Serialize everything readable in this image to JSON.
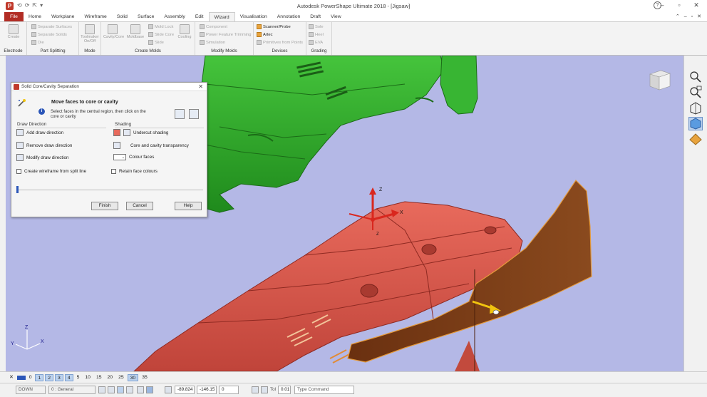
{
  "app": {
    "icon_letter": "P",
    "title": "Autodesk PowerShape Ultimate 2018 - [Jigsaw]",
    "window_controls": [
      "–",
      "▫",
      "✕"
    ],
    "help": "?",
    "quick_access": [
      "⟲",
      "⟳",
      "⇱",
      "▾"
    ]
  },
  "tabs": [
    "File",
    "Home",
    "Workplane",
    "Wireframe",
    "Solid",
    "Surface",
    "Assembly",
    "Edit",
    "Wizard",
    "Visualisation",
    "Annotation",
    "Draft",
    "View"
  ],
  "active_tab": "Wizard",
  "tabs_right": [
    "⌃",
    "–",
    "▫",
    "✕"
  ],
  "ribbon": {
    "groups": [
      {
        "label": "Electrode",
        "buttons": [
          "Create"
        ]
      },
      {
        "label": "Part Splitting",
        "buttons": [
          "Separate Surfaces",
          "Separate Solids",
          "Die"
        ]
      },
      {
        "label": "Mode",
        "buttons": [
          "Toolmaker On/Off"
        ]
      },
      {
        "label": "Create Molds",
        "buttons": [
          "Cavity/Core",
          "Moldbase",
          "Mold Lock",
          "Slide Core",
          "Slide",
          "Cooling"
        ]
      },
      {
        "label": "Modify Molds",
        "buttons": [
          "Component",
          "Power Feature Trimming",
          "Simulation"
        ]
      },
      {
        "label": "Devices",
        "buttons": [
          "Scanner/Probe",
          "Artec",
          "Primitives from Points"
        ]
      },
      {
        "label": "Grading",
        "buttons": [
          "Sole",
          "Heel",
          "EVA"
        ]
      }
    ]
  },
  "dialog": {
    "title": "Solid Core/Cavity Separation",
    "close": "✕",
    "heading": "Move faces to core or cavity",
    "info_icon": "i",
    "info": "Select faces in the central region, then click on the core or cavity",
    "draw_direction": {
      "label": "Draw Direction",
      "items": [
        "Add draw direction",
        "Remove draw direction",
        "Modify draw direction"
      ]
    },
    "shading": {
      "label": "Shading",
      "items": [
        "Undercut shading",
        "Core and cavity transparency",
        "Colour faces"
      ]
    },
    "checkboxes": {
      "wireframe": "Create wireframe from split line",
      "retain": "Retain face colours"
    },
    "slider_value": 0,
    "buttons": {
      "finish": "Finish",
      "cancel": "Cancel",
      "help": "Help"
    }
  },
  "viewport": {
    "axis_labels": {
      "x": "X",
      "y": "Y",
      "z": "Z"
    },
    "colors": {
      "background": "#b4b8e6",
      "core": "#2fa82a",
      "cavity": "#d9534a",
      "parting": "#7a3a16"
    }
  },
  "viewbar": {
    "close": "✕",
    "items": [
      "0",
      "1",
      "2",
      "3",
      "4",
      "5",
      "10",
      "15",
      "20",
      "25",
      "30",
      "35"
    ],
    "selected": [
      "1",
      "2",
      "3",
      "4",
      "30"
    ]
  },
  "statusbar": {
    "mode": "DOWN",
    "level": "0 : General",
    "x": "-89.824",
    "y": "-146.15",
    "z": "0",
    "tol_label": "Tol",
    "tol": "0.01",
    "command_placeholder": "Type Command"
  }
}
